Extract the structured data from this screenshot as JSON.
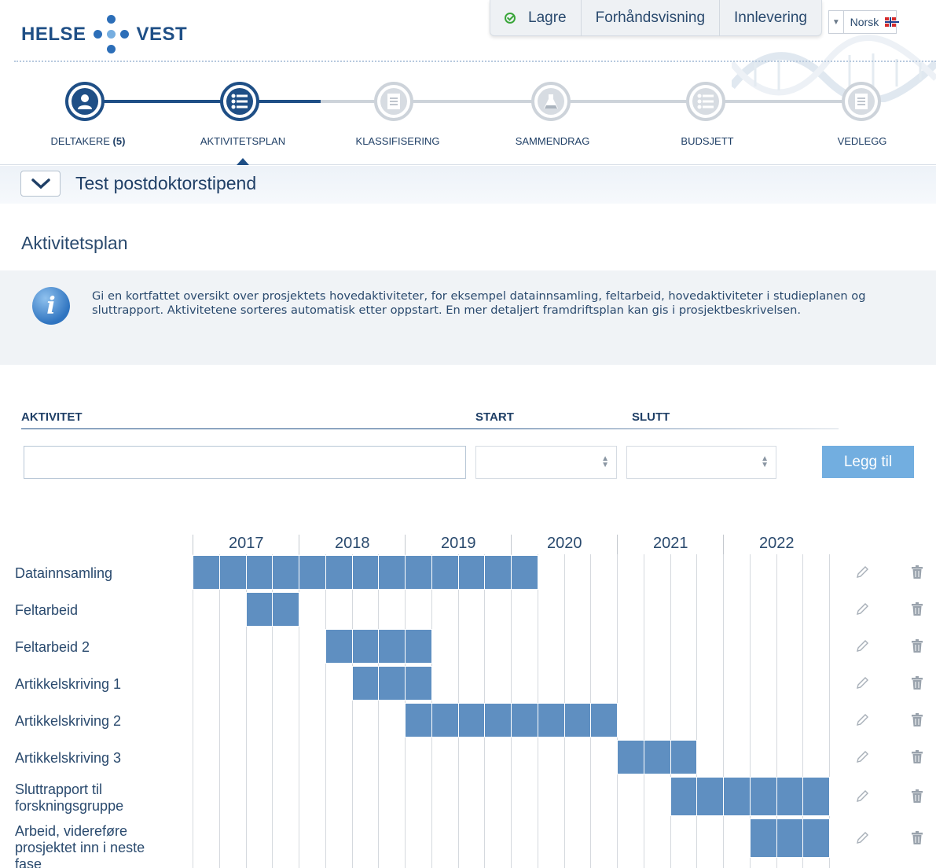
{
  "brand": {
    "left": "HELSE",
    "right": "VEST"
  },
  "toolbar": {
    "save_label": "Lagre",
    "preview_label": "Forhåndsvisning",
    "submit_label": "Innlevering"
  },
  "language": {
    "selected": "Norsk"
  },
  "steps": [
    {
      "label": "DELTAKERE",
      "count": "(5)"
    },
    {
      "label": "AKTIVITETSPLAN"
    },
    {
      "label": "KLASSIFISERING"
    },
    {
      "label": "SAMMENDRAG"
    },
    {
      "label": "BUDSJETT"
    },
    {
      "label": "VEDLEGG"
    }
  ],
  "page": {
    "title": "Test postdoktorstipend",
    "section_title": "Aktivitetsplan"
  },
  "info": {
    "text": "Gi en kortfattet oversikt over prosjektets hovedaktiviteter, for eksempel datainnsamling, feltarbeid, hovedaktiviteter i studieplanen og sluttrapport. Aktivitetene sorteres automatisk etter oppstart. En mer detaljert framdriftsplan kan gis i prosjektbeskrivelsen."
  },
  "form": {
    "activity_header": "AKTIVITET",
    "start_header": "START",
    "end_header": "SLUTT",
    "activity_value": "",
    "start_value": "",
    "end_value": "",
    "add_label": "Legg til"
  },
  "gantt": {
    "years": [
      "2017",
      "2018",
      "2019",
      "2020",
      "2021",
      "2022"
    ],
    "periods_per_year": 4,
    "activities": [
      {
        "name": "Datainnsamling",
        "start": 0,
        "end": 13
      },
      {
        "name": "Feltarbeid",
        "start": 2,
        "end": 4
      },
      {
        "name": "Feltarbeid 2",
        "start": 5,
        "end": 9
      },
      {
        "name": "Artikkelskriving 1",
        "start": 6,
        "end": 9
      },
      {
        "name": "Artikkelskriving 2",
        "start": 8,
        "end": 16
      },
      {
        "name": "Artikkelskriving 3",
        "start": 16,
        "end": 19
      },
      {
        "name": "Sluttrapport til forskningsgruppe",
        "start": 18,
        "end": 24
      },
      {
        "name": "Arbeid, videreføre prosjektet inn i neste fase",
        "start": 21,
        "end": 24
      }
    ],
    "colors": {
      "bar": "#5f8fc1",
      "grid": "#d5d9de"
    }
  },
  "icons": {
    "edit": "pencil-icon",
    "delete": "trash-icon",
    "info": "info-icon",
    "save": "check-circle-icon"
  }
}
